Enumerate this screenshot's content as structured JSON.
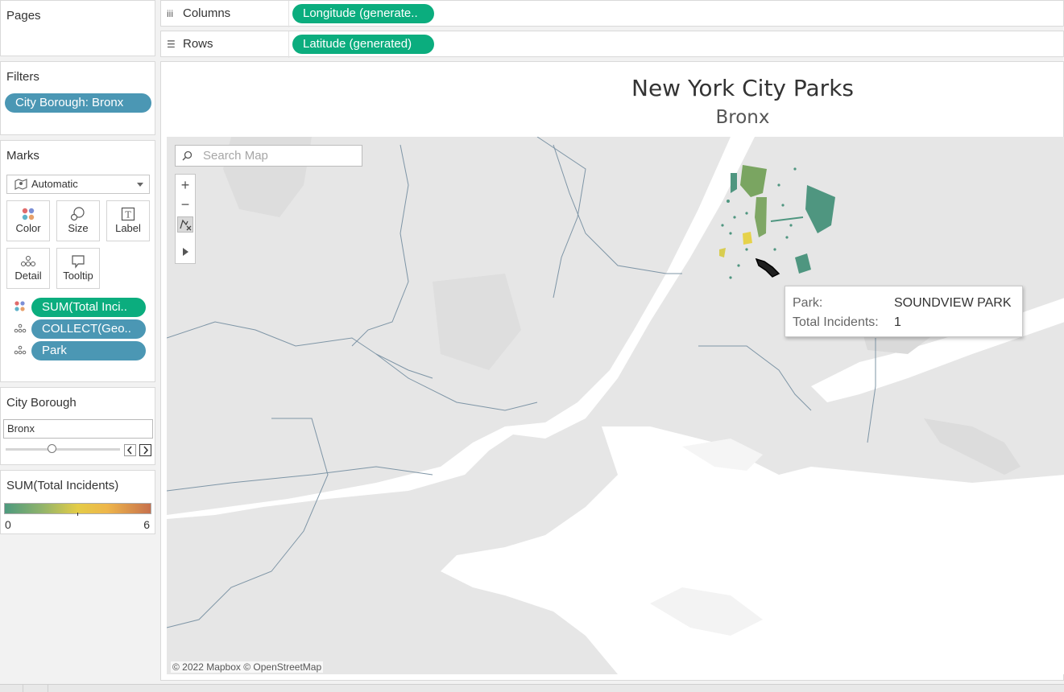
{
  "pages": {
    "title": "Pages"
  },
  "shelves": {
    "columns": {
      "label": "Columns",
      "pill": "Longitude (generate.."
    },
    "rows": {
      "label": "Rows",
      "pill": "Latitude (generated)"
    }
  },
  "filters": {
    "title": "Filters",
    "pill": "City Borough: Bronx"
  },
  "marks": {
    "title": "Marks",
    "type": "Automatic",
    "buttons": {
      "color": "Color",
      "size": "Size",
      "label": "Label",
      "detail": "Detail",
      "tooltip": "Tooltip"
    },
    "fields": [
      "SUM(Total Inci..",
      "COLLECT(Geo..",
      "Park"
    ]
  },
  "borough_control": {
    "title": "City Borough",
    "value": "Bronx"
  },
  "legend": {
    "title": "SUM(Total Incidents)",
    "min": "0",
    "max": "6",
    "colors": [
      "#4d9a7e",
      "#8fb36c",
      "#e4cc47",
      "#eeb64b",
      "#c7714d"
    ]
  },
  "viz": {
    "title": "New York City Parks",
    "subtitle": "Bronx"
  },
  "map": {
    "search_placeholder": "Search Map",
    "zoom_in": "+",
    "zoom_out": "−",
    "attribution": "© 2022 Mapbox © OpenStreetMap"
  },
  "tooltip": {
    "park_key": "Park:",
    "park_value": "SOUNDVIEW PARK",
    "incidents_key": "Total Incidents:",
    "incidents_value": "1"
  },
  "accent_colors": {
    "measure_pill": "#0bad7e",
    "dimension_pill": "#4b97b4"
  }
}
